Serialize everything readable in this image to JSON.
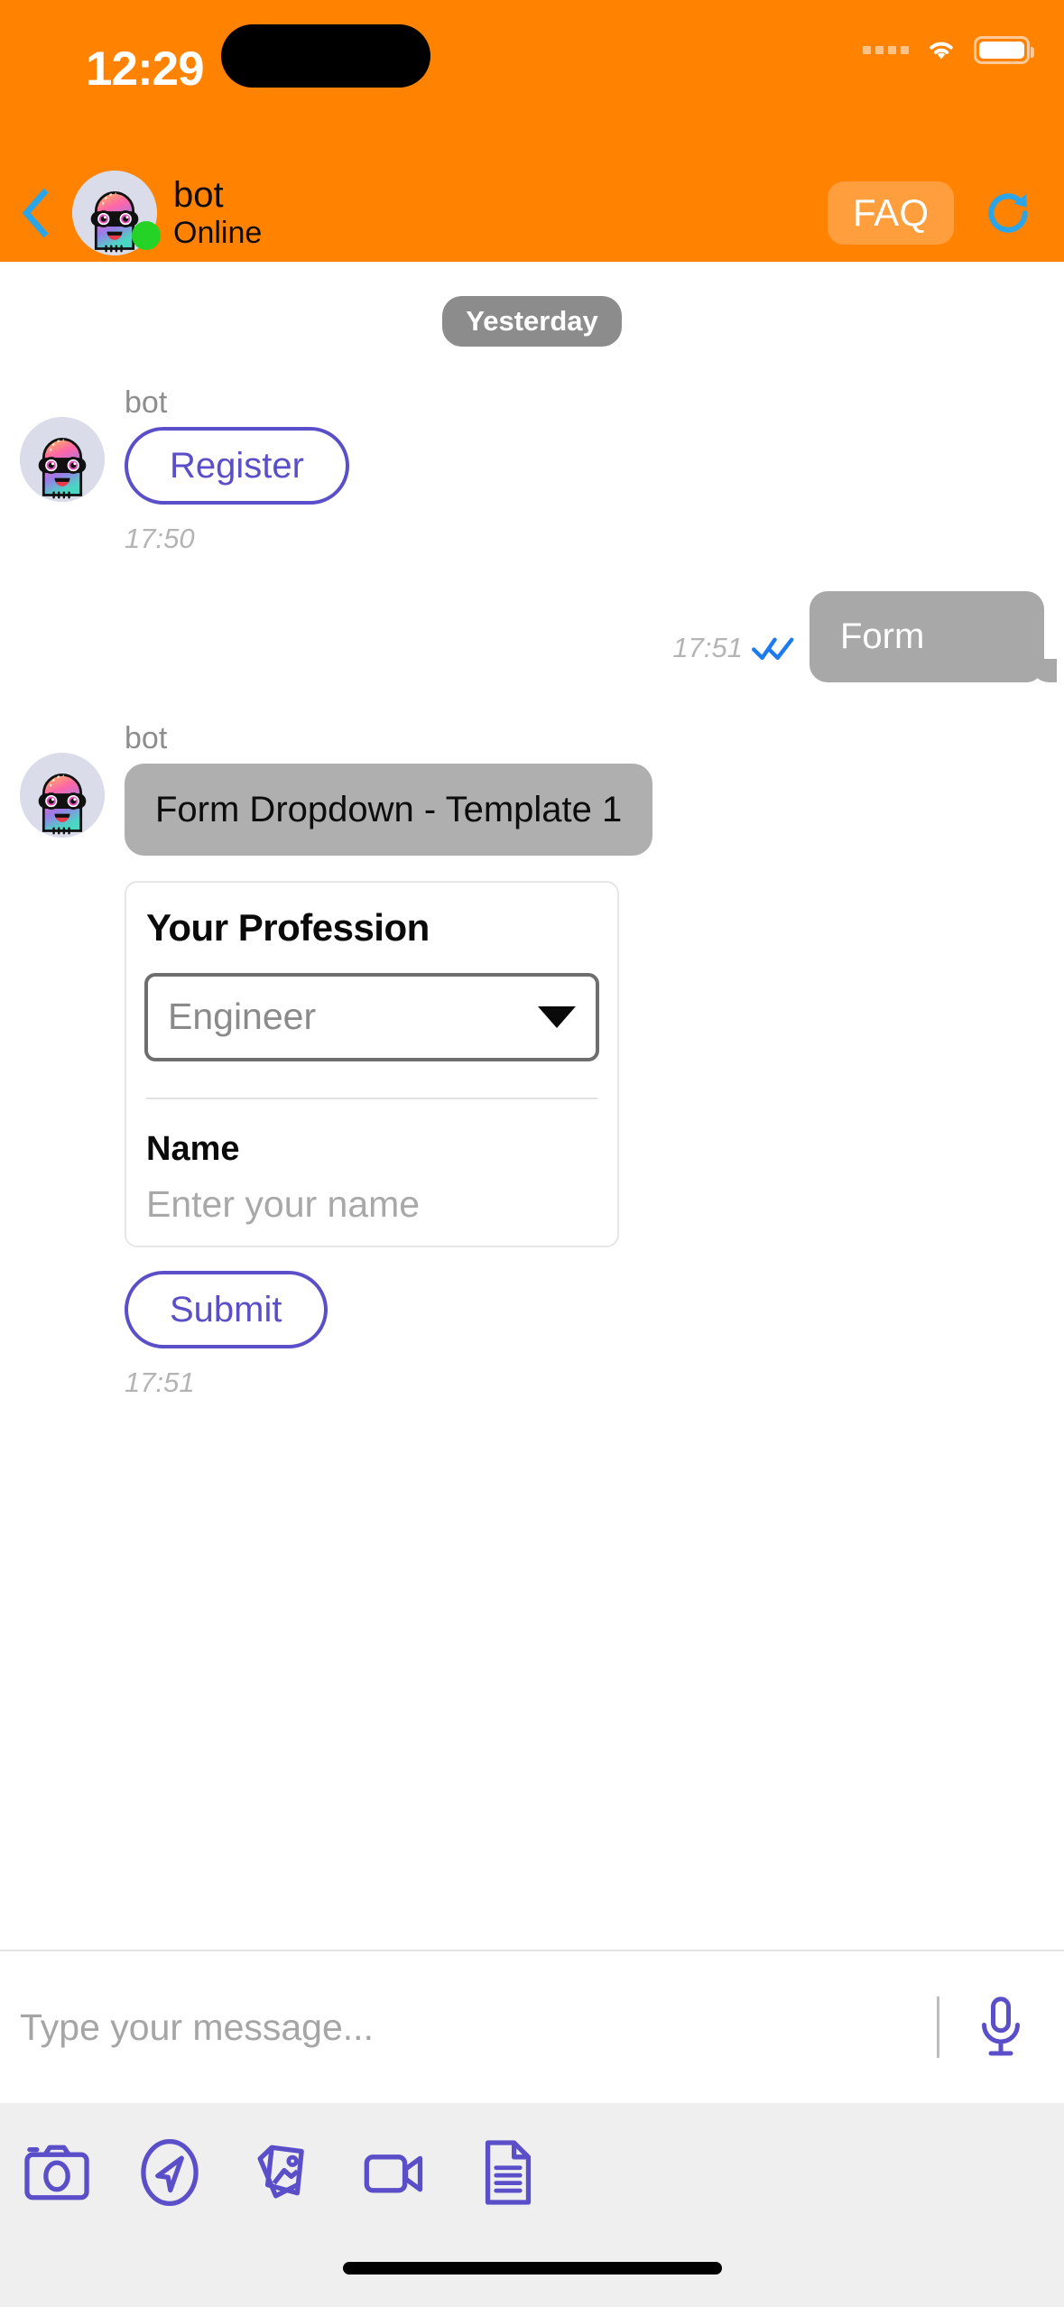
{
  "status_bar": {
    "time": "12:29",
    "icons": [
      "signal-dots-icon",
      "wifi-icon",
      "battery-icon"
    ]
  },
  "header": {
    "back_icon": "back-chevron-icon",
    "avatar_icon": "bot-avatar",
    "title": "bot",
    "subtitle": "Online",
    "presence_color": "#25D326",
    "faq_label": "FAQ",
    "refresh_icon": "refresh-icon",
    "background_color": "#FF8300"
  },
  "chat": {
    "date_separator": "Yesterday",
    "messages": [
      {
        "sender": "bot",
        "kind": "quick-reply",
        "button_label": "Register",
        "timestamp": "17:50"
      },
      {
        "sender": "user",
        "kind": "text",
        "text": "Form",
        "timestamp": "17:51",
        "status_icon": "double-check-icon"
      },
      {
        "sender": "bot",
        "kind": "form",
        "bubble_text": "Form Dropdown - Template 1",
        "form": {
          "heading": "Your Profession",
          "dropdown": {
            "value": "Engineer",
            "caret_icon": "chevron-down-icon"
          },
          "name_field": {
            "label": "Name",
            "placeholder": "Enter your name",
            "value": ""
          },
          "submit_label": "Submit"
        },
        "timestamp": "17:51"
      }
    ]
  },
  "composer": {
    "placeholder": "Type your message...",
    "value": "",
    "mic_icon": "microphone-icon"
  },
  "toolbar": {
    "items": [
      {
        "icon": "camera-icon"
      },
      {
        "icon": "location-send-icon"
      },
      {
        "icon": "gallery-icon"
      },
      {
        "icon": "video-camera-icon"
      },
      {
        "icon": "document-icon"
      }
    ]
  },
  "colors": {
    "brand_orange": "#FF8300",
    "accent_purple": "#5B4FC9",
    "bubble_gray": "#AFAFAF",
    "out_bubble_gray": "#A8A8A8"
  }
}
